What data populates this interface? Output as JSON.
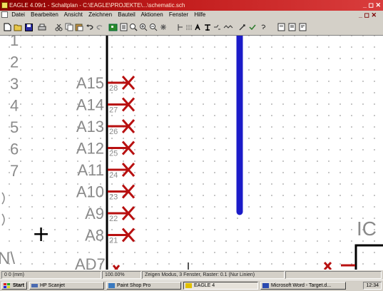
{
  "window": {
    "title": "EAGLE 4.09r1 - Schaltplan - C:\\EAGLE\\PROJEKTE\\...\\schematic.sch",
    "controls": "_ ◻ ✕"
  },
  "menu": {
    "items": [
      "Datei",
      "Bearbeiten",
      "Ansicht",
      "Zeichnen",
      "Bauteil",
      "Aktionen",
      "Fenster",
      "Hilfe"
    ],
    "mdi_controls": "_ ◻ ✕"
  },
  "toolbar": {
    "icons": [
      "new-icon",
      "open-icon",
      "save-icon",
      "print-icon",
      "cut-icon",
      "copy-icon",
      "paste-icon",
      "undo-icon",
      "redo-icon",
      "board-icon",
      "layer-icon",
      "zoom-fit-icon",
      "zoom-in-icon",
      "zoom-out-icon",
      "redraw-icon",
      "cut-mark-icon",
      "grid-icon",
      "ratsnest-icon",
      "bus-icon",
      "net-icon",
      "wire-icon",
      "run-ulp-icon",
      "script-icon",
      "help-icon",
      "page-icon"
    ]
  },
  "schematic": {
    "row_numbers": [
      "1",
      "2",
      "3",
      "4",
      "5",
      "6",
      "7"
    ],
    "pins": [
      {
        "name": "A15",
        "num": "28"
      },
      {
        "name": "A14",
        "num": "27"
      },
      {
        "name": "A13",
        "num": "26"
      },
      {
        "name": "A12",
        "num": "25"
      },
      {
        "name": "A11",
        "num": "24"
      },
      {
        "name": "A10",
        "num": "23"
      },
      {
        "name": "A9",
        "num": "22"
      },
      {
        "name": "A8",
        "num": "21"
      }
    ],
    "partial_bottom_pin": "AD7",
    "partial_left_label": "N\\",
    "partial_right_label": "IC",
    "crosshair": "+",
    "wire_color": "#1b1bc8",
    "pin_color": "#b81010",
    "text_color": "#8a8a8a"
  },
  "statusbar": {
    "coords": "0 0 (mm)",
    "zoom": "100.00%",
    "mode": "Zeigen Modus, 3 Fenster, Raster: 0.1 (Nur Linien)",
    "extra": ""
  },
  "taskbar": {
    "start": "Start",
    "buttons": [
      {
        "label": "HP Scanjet",
        "active": false
      },
      {
        "label": "Paint Shop Pro",
        "active": false
      },
      {
        "label": "EAGLE 4",
        "active": true
      },
      {
        "label": "Microsoft Word - Target.d...",
        "active": false
      }
    ],
    "clock": "12:34"
  }
}
